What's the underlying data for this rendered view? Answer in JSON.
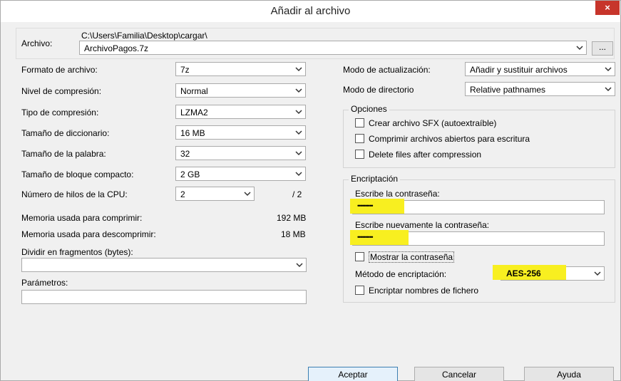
{
  "window": {
    "title": "Añadir al archivo",
    "close_symbol": "×"
  },
  "archive": {
    "label": "Archivo:",
    "path": "C:\\Users\\Familia\\Desktop\\cargar\\",
    "value": "ArchivoPagos.7z",
    "browse_label": "..."
  },
  "left": {
    "format_label": "Formato de archivo:",
    "format_value": "7z",
    "level_label": "Nivel de compresión:",
    "level_value": "Normal",
    "method_label": "Tipo de compresión:",
    "method_value": "LZMA2",
    "dict_label": "Tamaño de diccionario:",
    "dict_value": "16 MB",
    "word_label": "Tamaño de la palabra:",
    "word_value": "32",
    "solid_label": "Tamaño de bloque compacto:",
    "solid_value": "2 GB",
    "threads_label": "Número de hilos de la CPU:",
    "threads_value": "2",
    "threads_max": "/ 2",
    "mem_comp_label": "Memoria usada para comprimir:",
    "mem_comp_value": "192 MB",
    "mem_decomp_label": "Memoria usada para descomprimir:",
    "mem_decomp_value": "18 MB",
    "split_label": "Dividir en fragmentos (bytes):",
    "split_value": "",
    "params_label": "Parámetros:",
    "params_value": ""
  },
  "right": {
    "update_label": "Modo de actualización:",
    "update_value": "Añadir y sustituir archivos",
    "path_mode_label": "Modo de directorio",
    "path_mode_value": "Relative pathnames",
    "options_title": "Opciones",
    "opt_sfx": "Crear archivo SFX (autoextraíble)",
    "opt_shared": "Comprimir archivos abiertos para escritura",
    "opt_delete": "Delete files after compression",
    "enc_title": "Encriptación",
    "pwd_label": "Escribe la contraseña:",
    "pwd_value": "••••••••••",
    "pwd2_label": "Escribe nuevamente la contraseña:",
    "pwd2_value": "••••••••••",
    "show_pwd": "Mostrar la contraseña",
    "enc_method_label": "Método de encriptación:",
    "enc_method_value": "AES-256",
    "enc_names": "Encriptar nombres de fichero"
  },
  "buttons": {
    "ok": "Aceptar",
    "cancel": "Cancelar",
    "help": "Ayuda"
  },
  "colors": {
    "highlight": "#f8ef20",
    "close": "#c7352b",
    "default_button_border": "#3c7fb1"
  },
  "icons": {
    "combo_arrow": "chevron-down-icon"
  }
}
